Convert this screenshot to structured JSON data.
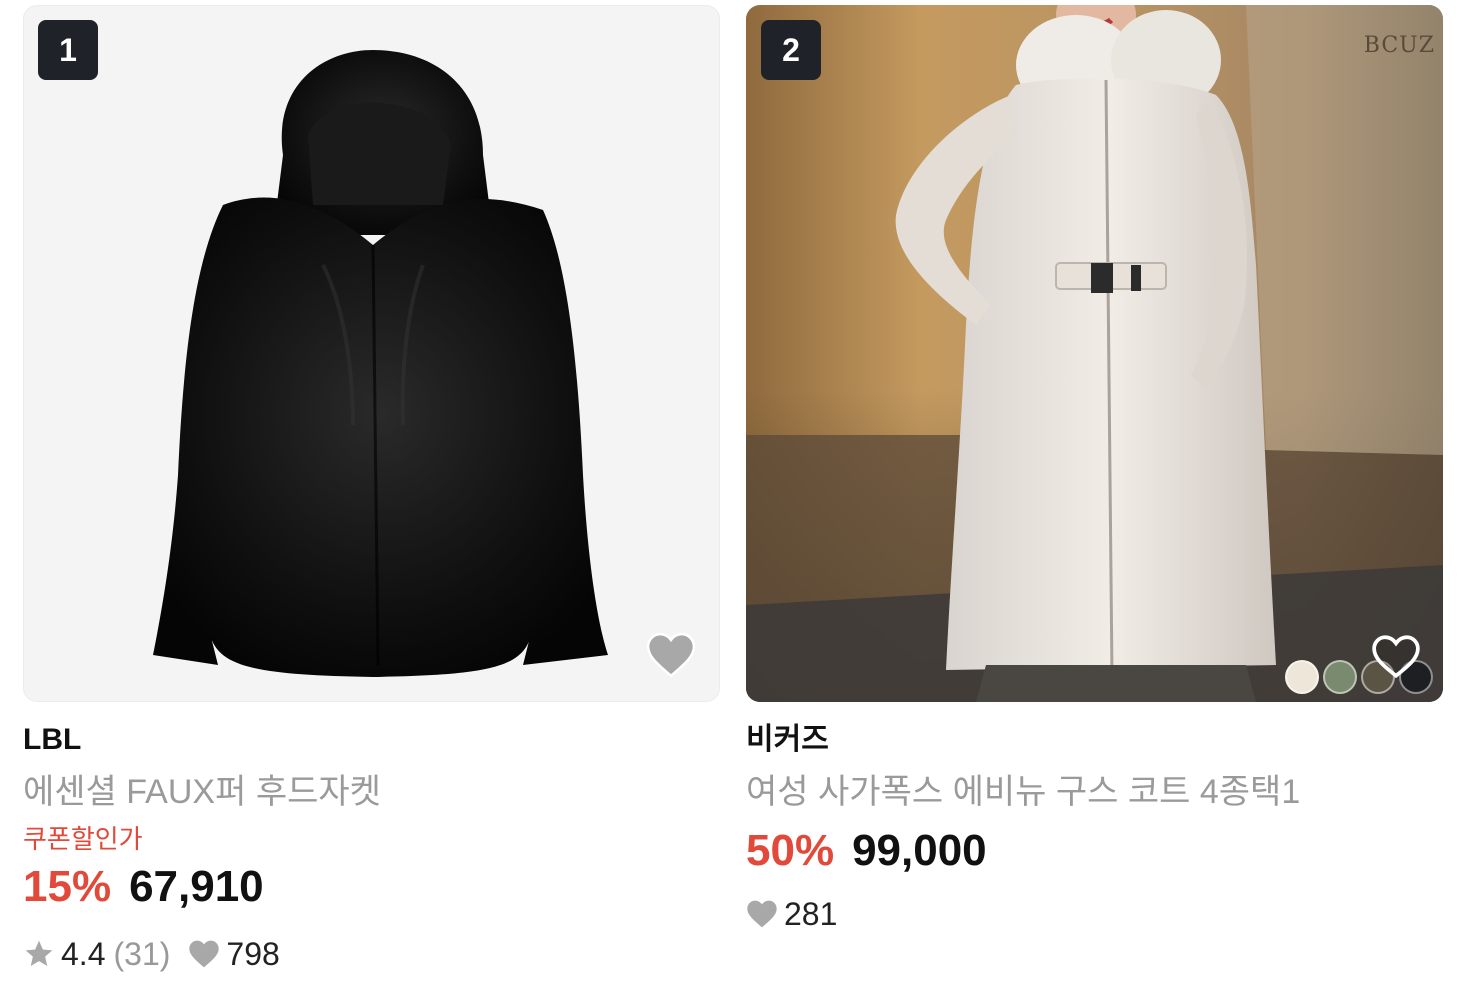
{
  "colors": {
    "accent_red": "#e1493a",
    "text_dark": "#111111",
    "text_muted": "#9a9a9a",
    "rank_bg": "#1f2329"
  },
  "products": [
    {
      "rank": "1",
      "brand": "LBL",
      "title": "에센셜 FAUX퍼 후드자켓",
      "coupon_label": "쿠폰할인가",
      "discount": "15%",
      "price": "67,910",
      "rating": "4.4",
      "review_count": "(31)",
      "likes": "798",
      "liked_icon": "heart-filled-icon"
    },
    {
      "rank": "2",
      "brand": "비커즈",
      "title": "여성 사가폭스 에비뉴 구스 코트 4종택1",
      "discount": "50%",
      "price": "99,000",
      "likes": "281",
      "image_logo": "BCUZ",
      "swatches": [
        "#efe6da",
        "#7a8a6e",
        "#5a5444",
        "#1d1f22"
      ],
      "liked_icon": "heart-outline-icon"
    }
  ]
}
